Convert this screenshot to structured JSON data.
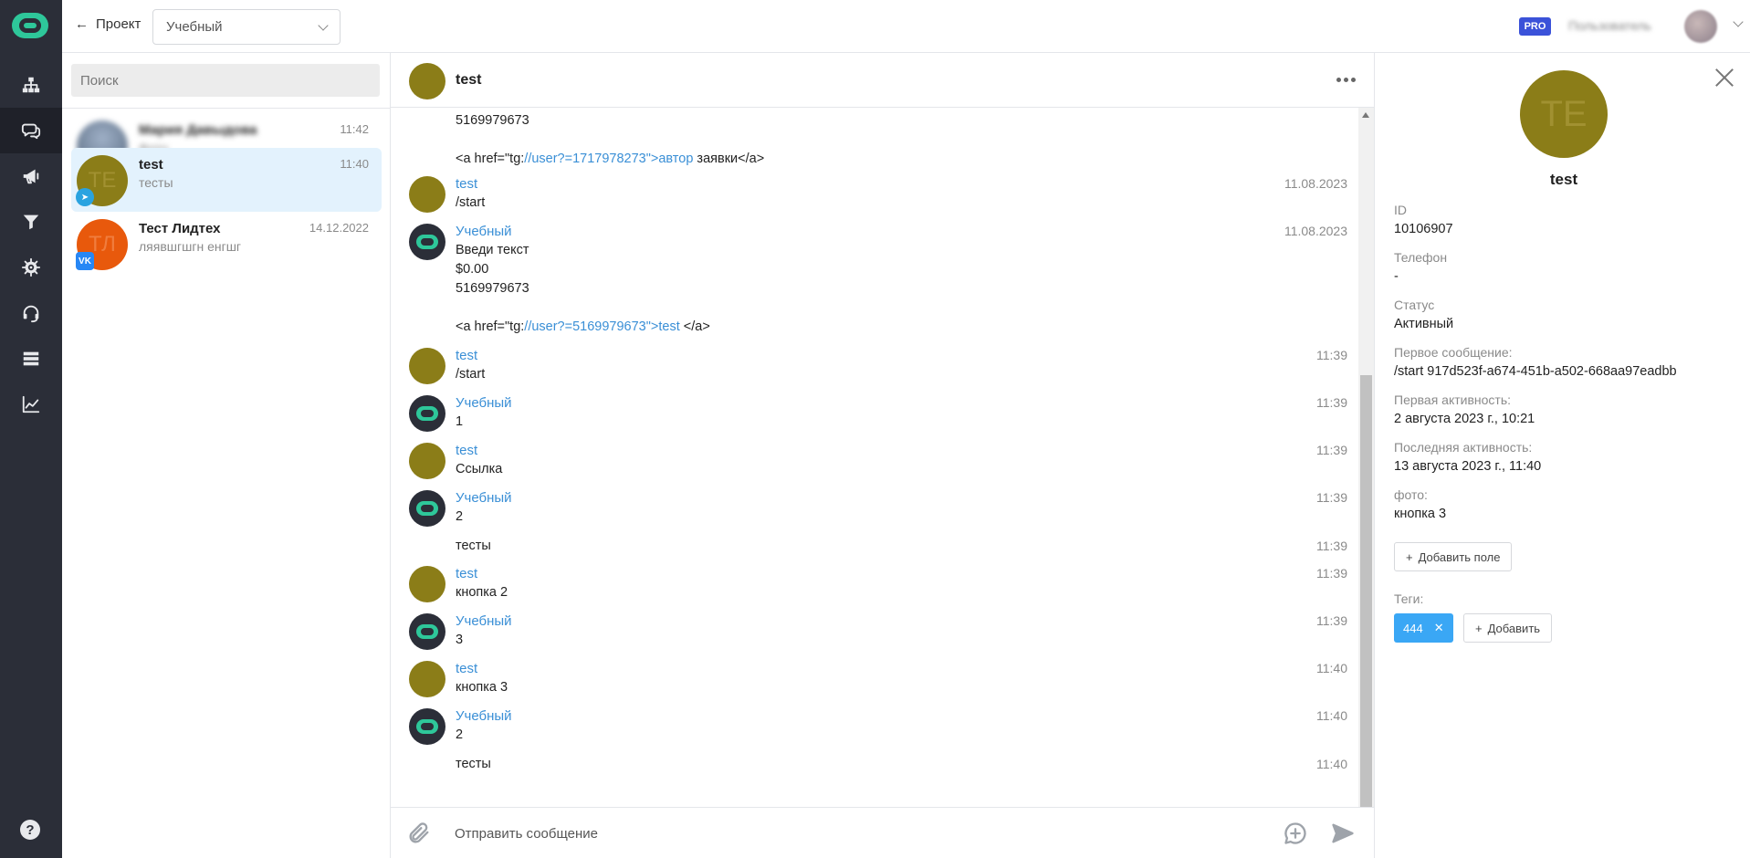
{
  "topbar": {
    "back_label": "Проект",
    "project_select": "Учебный",
    "pro_badge": "PRO",
    "user_name": "Пользователь"
  },
  "sidebar": {
    "items": [
      {
        "icon": "sitemap-icon"
      },
      {
        "icon": "chats-icon",
        "active": true
      },
      {
        "icon": "megaphone-icon"
      },
      {
        "icon": "funnel-icon"
      },
      {
        "icon": "gear-icon"
      },
      {
        "icon": "headset-icon"
      },
      {
        "icon": "database-icon"
      },
      {
        "icon": "analytics-icon"
      }
    ],
    "help": "?"
  },
  "search": {
    "placeholder": "Поиск"
  },
  "conversations": [
    {
      "name": "Мария Давыдова",
      "preview": "Фото",
      "time": "11:42",
      "channel": "telegram",
      "blurred": true
    },
    {
      "name": "test",
      "preview": "тесты",
      "time": "11:40",
      "initials": "TE",
      "channel": "telegram",
      "active": true
    },
    {
      "name": "Тест Лидтех",
      "preview": "ляявшгшгн енгшг",
      "time": "14.12.2022",
      "initials": "ТЛ",
      "channel": "vk"
    }
  ],
  "chat": {
    "title": "test",
    "top_fragment": "5169979673",
    "top_link_line": {
      "pre": "<a href=\"tg:",
      "link": "//user?=1717978273\">автор",
      "post": " заявки</a>"
    },
    "messages": [
      {
        "sender": "test",
        "type": "user",
        "time": "11.08.2023",
        "lines": [
          "/start"
        ]
      },
      {
        "sender": "Учебный",
        "type": "bot",
        "time": "11.08.2023",
        "lines": [
          "Введи текст",
          "$0.00",
          "5169979673",
          ""
        ],
        "link_line": {
          "pre": "<a href=\"tg:",
          "link": "//user?=5169979673\">test",
          "post": " </a>"
        }
      },
      {
        "sender": "test",
        "type": "user",
        "time": "11:39",
        "lines": [
          "/start"
        ]
      },
      {
        "sender": "Учебный",
        "type": "bot",
        "time": "11:39",
        "lines": [
          "1"
        ]
      },
      {
        "sender": "test",
        "type": "user",
        "time": "11:39",
        "lines": [
          "Ссылка"
        ]
      },
      {
        "sender": "Учебный",
        "type": "bot",
        "time": "11:39",
        "lines": [
          "2"
        ]
      },
      {
        "sender": "",
        "type": "cont",
        "time": "11:39",
        "lines": [
          "тесты"
        ]
      },
      {
        "sender": "test",
        "type": "user",
        "time": "11:39",
        "lines": [
          "кнопка 2"
        ]
      },
      {
        "sender": "Учебный",
        "type": "bot",
        "time": "11:39",
        "lines": [
          "3"
        ]
      },
      {
        "sender": "test",
        "type": "user",
        "time": "11:40",
        "lines": [
          "кнопка 3"
        ]
      },
      {
        "sender": "Учебный",
        "type": "bot",
        "time": "11:40",
        "lines": [
          "2"
        ]
      },
      {
        "sender": "",
        "type": "cont",
        "time": "11:40",
        "lines": [
          "тесты"
        ]
      }
    ],
    "composer_placeholder": "Отправить сообщение"
  },
  "details": {
    "initials": "TE",
    "name": "test",
    "fields": [
      {
        "label": "ID",
        "value": "10106907"
      },
      {
        "label": "Телефон",
        "value": "-"
      },
      {
        "label": "Статус",
        "value": "Активный"
      },
      {
        "label": "Первое сообщение:",
        "value": "/start 917d523f-a674-451b-a502-668aa97eadbb"
      },
      {
        "label": "Первая активность:",
        "value": "2 августа 2023 г., 10:21"
      },
      {
        "label": "Последняя активность:",
        "value": "13 августа 2023 г., 11:40"
      },
      {
        "label": "фото:",
        "value": "кнопка 3"
      }
    ],
    "add_field_label": "Добавить поле",
    "tags_label": "Теги:",
    "tags": [
      "444"
    ],
    "add_tag_label": "Добавить"
  },
  "colors": {
    "sidebar_bg": "#2b2e38",
    "brand_green": "#2ec79a",
    "link_blue": "#3a8fd6",
    "active_row": "#e3f2fd",
    "user_avatar": "#8b7d18",
    "vk_avatar": "#e8590c",
    "tag_blue": "#3aa7f5",
    "pro_blue": "#3b52d9"
  }
}
